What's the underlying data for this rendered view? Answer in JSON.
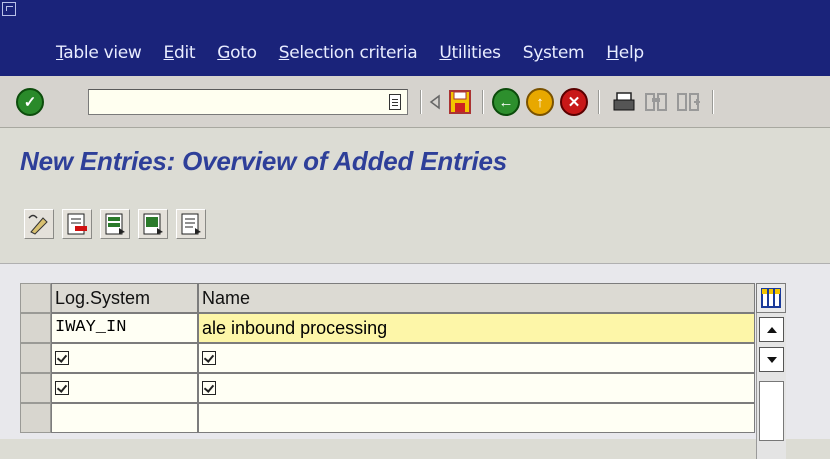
{
  "menu": {
    "items": [
      {
        "pre": "",
        "u": "T",
        "post": "able view"
      },
      {
        "pre": "",
        "u": "E",
        "post": "dit"
      },
      {
        "pre": "",
        "u": "G",
        "post": "oto"
      },
      {
        "pre": "",
        "u": "S",
        "post": "election criteria"
      },
      {
        "pre": "",
        "u": "U",
        "post": "tilities"
      },
      {
        "pre": "S",
        "u": "y",
        "post": "stem"
      },
      {
        "pre": "",
        "u": "H",
        "post": "elp"
      }
    ]
  },
  "toolbar": {
    "command_field_value": "",
    "icons": [
      "enter-icon",
      "back-nav-icon",
      "save-icon",
      "back-icon",
      "exit-icon",
      "cancel-icon",
      "print-icon",
      "find-icon",
      "find-next-icon"
    ]
  },
  "page": {
    "title": "New Entries: Overview of Added Entries"
  },
  "app_toolbar": {
    "icons": [
      "change-display-icon",
      "delete-icon",
      "select-all-icon",
      "select-block-icon",
      "deselect-all-icon"
    ]
  },
  "table": {
    "columns": [
      "Log.System",
      "Name"
    ],
    "rows": [
      {
        "log_system": "IWAY_IN",
        "name": "ale inbound processing"
      },
      {
        "log_system": "",
        "name": ""
      },
      {
        "log_system": "",
        "name": ""
      }
    ]
  },
  "colors": {
    "menubar": "#1a237a",
    "title": "#2e3f99",
    "highlight_row": "#fdf6a8"
  }
}
